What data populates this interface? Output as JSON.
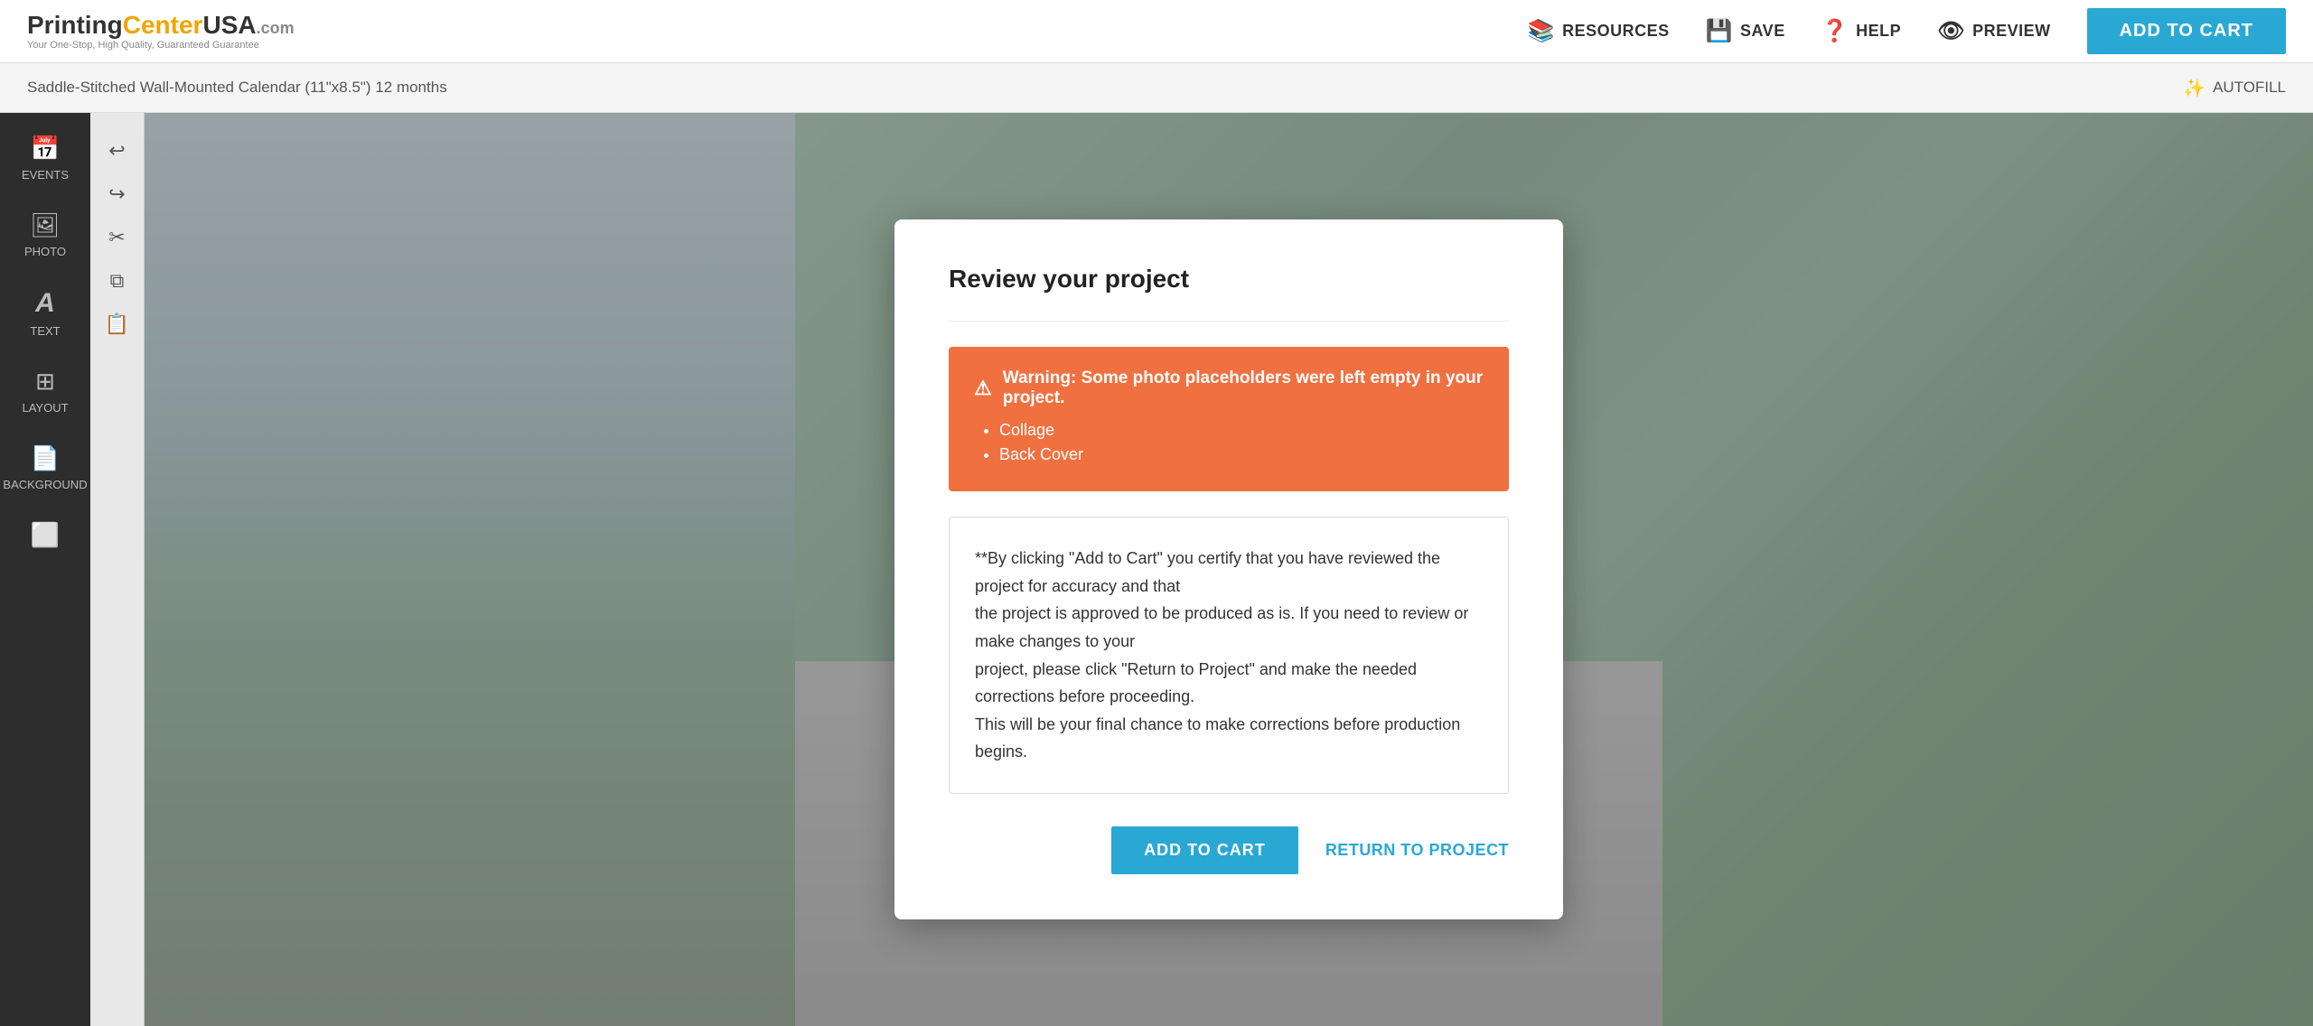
{
  "header": {
    "logo": {
      "printing": "Printing",
      "center": "Center",
      "usa": "USA",
      "com": ".com",
      "tagline": "Your One-Stop, High Quality, Guaranteed Guarantee"
    },
    "nav": {
      "resources_label": "RESOURCES",
      "save_label": "SAVE",
      "help_label": "HELP",
      "preview_label": "PREVIEW",
      "add_to_cart_label": "ADD TO CART"
    }
  },
  "breadcrumb": {
    "text": "Saddle-Stitched Wall-Mounted Calendar (11\"x8.5\") 12 months",
    "autofill_label": "AUTOFILL"
  },
  "sidebar": {
    "items": [
      {
        "label": "EVENTS",
        "icon": "📅"
      },
      {
        "label": "PHOTO",
        "icon": "🖼"
      },
      {
        "label": "TEXT",
        "icon": "A"
      },
      {
        "label": "LAYOUT",
        "icon": "⊞"
      },
      {
        "label": "BACKGROUND",
        "icon": "📄"
      },
      {
        "label": "",
        "icon": "⬜"
      }
    ]
  },
  "tools": {
    "undo_icon": "↩",
    "redo_icon": "↪",
    "cut_icon": "✂",
    "copy_icon": "⧉",
    "paste_icon": "📋"
  },
  "modal": {
    "title": "Review your project",
    "warning": {
      "header": "Warning: Some photo placeholders were left empty in your project.",
      "items": [
        "Collage",
        "Back Cover"
      ]
    },
    "cert_text_1": "**By clicking \"Add to Cart\" you certify that you have reviewed the project for accuracy and that",
    "cert_text_2": "the project is approved to be produced as is. If you need to review or make changes to your",
    "cert_text_3": "project, please click \"Return to Project\" and make the needed corrections before proceeding.",
    "cert_text_4": "This will be your final chance to make corrections before production begins.",
    "add_to_cart_label": "ADD TO CART",
    "return_label": "RETURN TO PROJECT"
  }
}
